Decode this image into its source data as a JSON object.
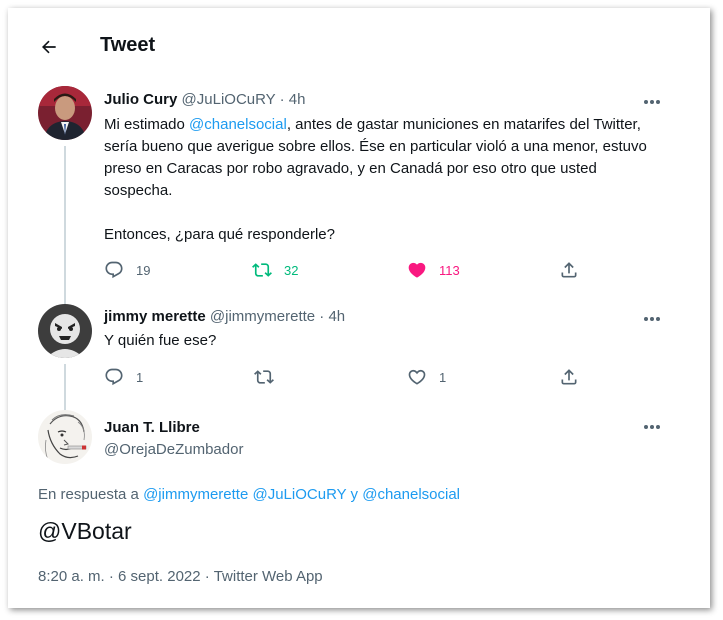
{
  "header": {
    "title": "Tweet"
  },
  "tweets": [
    {
      "display_name": "Julio Cury",
      "handle": "@JuLiOCuRY",
      "separator": "·",
      "time": "4h",
      "text_parts": [
        "Mi estimado ",
        "@chanelsocial",
        ", antes de gastar municiones en matarifes del Twitter, sería bueno que averigue sobre ellos. Ése en particular violó a una menor, estuvo preso en Caracas por robo agravado, y en Canadá por eso otro que usted sospecha.",
        "Entonces, ¿para qué responderle?"
      ],
      "replies": "19",
      "retweets": "32",
      "likes": "113"
    },
    {
      "display_name": "jimmy merette",
      "handle": "@jimmymerette",
      "separator": "·",
      "time": "4h",
      "text": "Y quién fue ese?",
      "replies": "1",
      "retweets": "",
      "likes": "1"
    }
  ],
  "main_tweet": {
    "display_name": "Juan T. Llibre",
    "handle": "@OrejaDeZumbador",
    "reply_prefix": "En respuesta a",
    "reply_to_1": "@jimmymerette",
    "reply_to_2": "@JuLiOCuRY",
    "reply_conj": "y",
    "reply_to_3": "@chanelsocial",
    "text": "@VBotar",
    "time": "8:20 a. m.",
    "date": "6 sept. 2022",
    "source": "Twitter Web App",
    "separator": "·"
  },
  "colors": {
    "accent": "#1d9bf0",
    "retweet_active": "#00ba7c",
    "like_active": "#f91880",
    "secondary_text": "#536471"
  }
}
